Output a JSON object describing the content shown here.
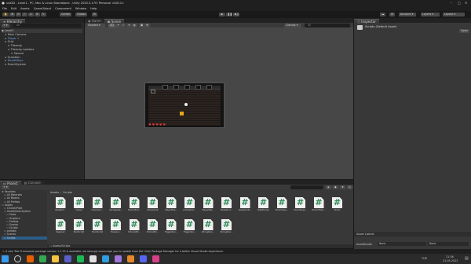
{
  "window": {
    "title": "scd2D - Level1 - PC, Mac & Linux Standalone - Unity 2020.3.17f1 Personal <DX11>"
  },
  "menu": [
    "File",
    "Edit",
    "Assets",
    "GameObject",
    "Component",
    "Window",
    "Help"
  ],
  "toolbar": {
    "pivot": "Center",
    "space": "Global",
    "account": "Account",
    "layers": "Layers",
    "layout": "Layout"
  },
  "hierarchy": {
    "tab": "Hierarchy",
    "search_placeholder": "All",
    "items": [
      {
        "label": "Level1",
        "depth": 0
      },
      {
        "label": "Main Camera",
        "depth": 1
      },
      {
        "label": "Player 1",
        "depth": 1
      },
      {
        "label": "Grid",
        "depth": 1
      },
      {
        "label": "Tilemap",
        "depth": 2
      },
      {
        "label": "Tilemap Ladders",
        "depth": 2
      },
      {
        "label": "Square",
        "depth": 3
      },
      {
        "label": "Question",
        "depth": 1
      },
      {
        "label": "HealthBars",
        "depth": 1
      },
      {
        "label": "EventSystem",
        "depth": 1
      }
    ]
  },
  "scene": {
    "tabs": [
      "Game",
      "Scene"
    ],
    "shading": "Shaded",
    "mode_2d": "2D",
    "gizmos": "Gizmos",
    "search_placeholder": "All"
  },
  "inspector": {
    "tab": "Inspector",
    "object": "Scripts (Default Asset)",
    "open_label": "Open",
    "asset_labels": "Asset Labels",
    "assetbundle_label": "AssetBundle",
    "assetbundle_value": "None",
    "variant_value": "None"
  },
  "project": {
    "tabs": [
      "Project",
      "Console"
    ],
    "tree": [
      {
        "label": "Favorites",
        "depth": 0
      },
      {
        "label": "All Materials",
        "depth": 1
      },
      {
        "label": "All Models",
        "depth": 1
      },
      {
        "label": "All Prefabs",
        "depth": 1
      },
      {
        "label": "Assets",
        "depth": 0
      },
      {
        "label": "ChickenPixel",
        "depth": 1
      },
      {
        "label": "HealthHeartSystem",
        "depth": 1
      },
      {
        "label": "Fonts",
        "depth": 2
      },
      {
        "label": "Graphics",
        "depth": 2
      },
      {
        "label": "Prefabs",
        "depth": 2
      },
      {
        "label": "Scenes",
        "depth": 2
      },
      {
        "label": "Scripts",
        "depth": 2
      },
      {
        "label": "prefabs",
        "depth": 1
      },
      {
        "label": "Scenes",
        "depth": 1
      },
      {
        "label": "Scripts",
        "depth": 1
      }
    ],
    "breadcrumb": [
      "Assets",
      "Scripts"
    ],
    "path_footer": "Assets/Scripts",
    "assets_row1": [
      "BaseEnt...",
      "Chase",
      "CheckGro...",
      "damageDe...",
      "EnemyFoll...",
      "Movement",
      "PlayerHea...",
      "portalsCon...",
      "PlayerWal...",
      "PauseScri...",
      "QuestionTo...",
      "RightScript",
      "Room1Sup...",
      "Room2Sup...",
      "Room3Tran...",
      "Shoot"
    ],
    "assets_row2": [
      "Spawner",
      "TankScript",
      "TrackScript",
      "Transpor...",
      "Tutorial3D...",
      "TutorialEn...",
      "TriggerSon...",
      "TriggerSpr...",
      "WrongDoo...",
      "WrongDoo..."
    ]
  },
  "status": {
    "message": "A new Test Framework package version 1.1.33 is available, we strongly encourage you to update from the Unity Package Manager for a better Visual Studio experience."
  },
  "taskbar": {
    "lang": "TUR",
    "time": "21:36",
    "date": "21.05.2022",
    "apps": [
      {
        "name": "start",
        "color": "#3a9bea"
      },
      {
        "name": "search",
        "color": "#d0d0d0"
      },
      {
        "name": "firefox",
        "color": "#e66000"
      },
      {
        "name": "chrome",
        "color": "#34a853"
      },
      {
        "name": "explorer",
        "color": "#f5c242"
      },
      {
        "name": "teams",
        "color": "#5b5fc7"
      },
      {
        "name": "spotify",
        "color": "#1db954"
      },
      {
        "name": "unity",
        "color": "#e0e0e0"
      },
      {
        "name": "vscode",
        "color": "#2f9de0"
      },
      {
        "name": "visual-studio",
        "color": "#a077dd"
      },
      {
        "name": "blender",
        "color": "#e8882a"
      },
      {
        "name": "discord",
        "color": "#5865f2"
      },
      {
        "name": "app-pink",
        "color": "#d83f87"
      }
    ]
  }
}
